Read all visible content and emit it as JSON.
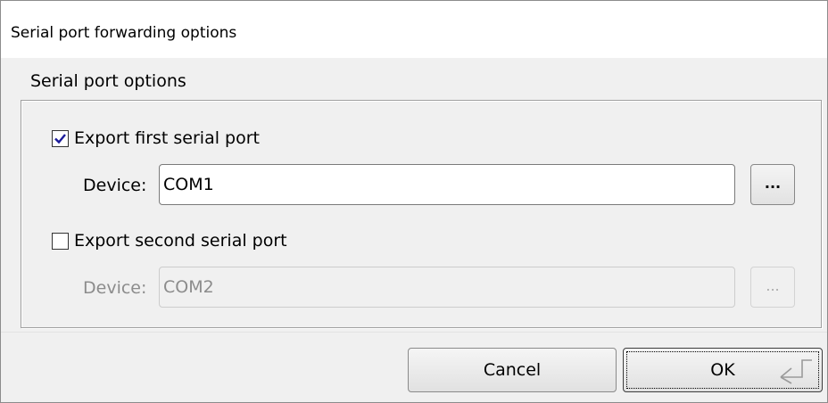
{
  "window": {
    "title": "Serial port forwarding options"
  },
  "group": {
    "label": "Serial port options",
    "first": {
      "checkbox_label": "Export first serial port",
      "checked": true,
      "device_label": "Device:",
      "device_value": "COM1",
      "browse_label": "..."
    },
    "second": {
      "checkbox_label": "Export second serial port",
      "checked": false,
      "device_label": "Device:",
      "device_value": "COM2",
      "browse_label": "..."
    }
  },
  "buttons": {
    "cancel_label": "Cancel",
    "ok_label": "OK"
  },
  "icons": {
    "check": "checkmark-icon",
    "enter": "enter-key-icon"
  },
  "colors": {
    "checkmark": "#1a1a9a",
    "disabled_text": "#8c8c8c"
  }
}
